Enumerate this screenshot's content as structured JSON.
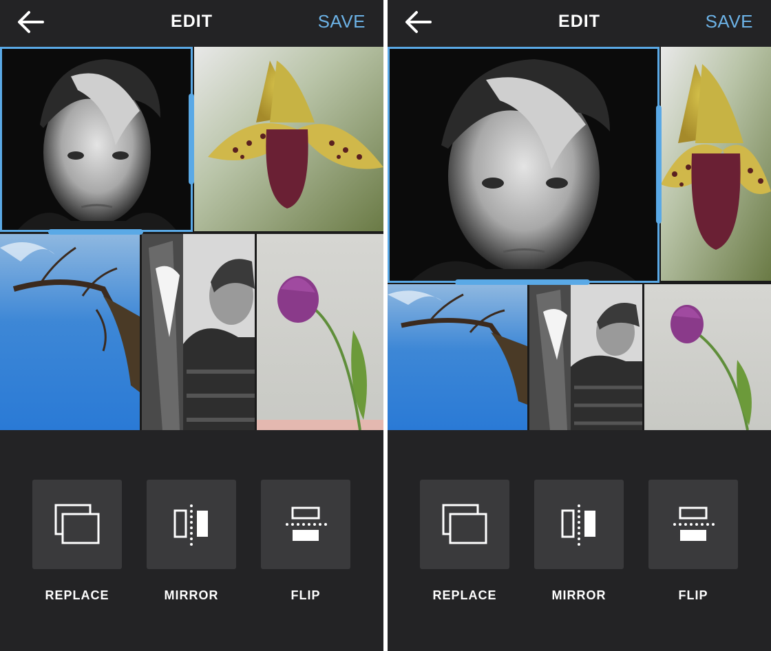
{
  "screens": [
    {
      "header": {
        "title": "EDIT",
        "save_label": "SAVE",
        "back_icon": "arrow-left-icon"
      },
      "tools": [
        {
          "label": "REPLACE",
          "icon": "replace-icon"
        },
        {
          "label": "MIRROR",
          "icon": "mirror-icon"
        },
        {
          "label": "FLIP",
          "icon": "flip-icon"
        }
      ]
    },
    {
      "header": {
        "title": "EDIT",
        "save_label": "SAVE",
        "back_icon": "arrow-left-icon"
      },
      "tools": [
        {
          "label": "REPLACE",
          "icon": "replace-icon"
        },
        {
          "label": "MIRROR",
          "icon": "mirror-icon"
        },
        {
          "label": "FLIP",
          "icon": "flip-icon"
        }
      ]
    }
  ],
  "colors": {
    "accent": "#6cb2e6",
    "selection": "#5aa9e6",
    "background": "#232325",
    "tool_button": "#3a3a3c"
  }
}
